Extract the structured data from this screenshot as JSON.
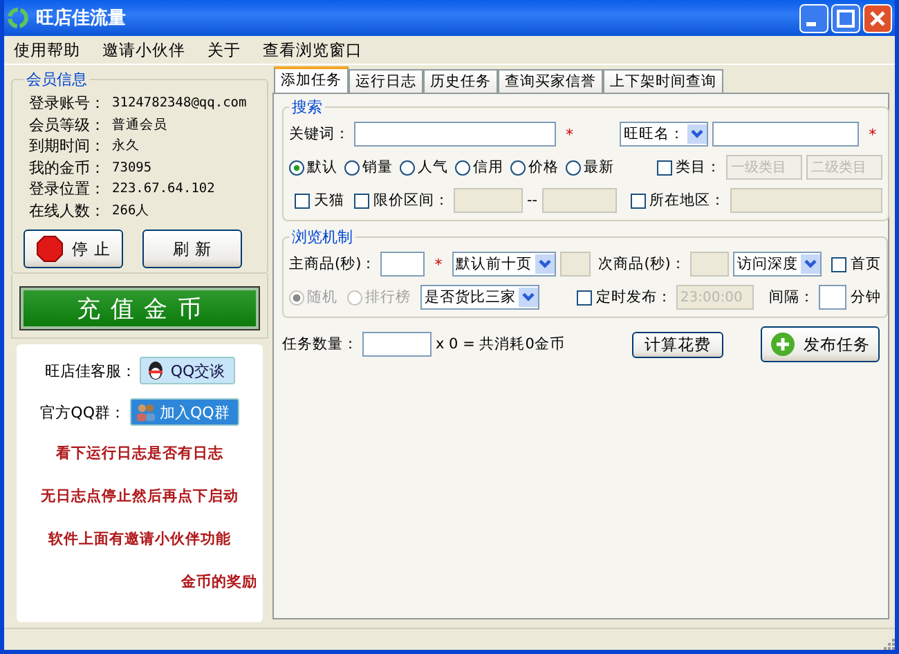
{
  "window": {
    "title": "旺店佳流量"
  },
  "menu": [
    "使用帮助",
    "邀请小伙伴",
    "关于",
    "查看浏览窗口"
  ],
  "member_info": {
    "title": "会员信息",
    "rows": [
      {
        "label": "登录账号：",
        "value": "3124782348@qq.com"
      },
      {
        "label": "会员等级：",
        "value": "普通会员"
      },
      {
        "label": "到期时间：",
        "value": "永久"
      },
      {
        "label": "我的金币：",
        "value": "73095"
      },
      {
        "label": "登录位置：",
        "value": "223.67.64.102"
      },
      {
        "label": "在线人数：",
        "value": "266人"
      }
    ]
  },
  "stop_button": "停 止",
  "refresh_button": "刷 新",
  "recharge_button": "充 值 金 币",
  "support": {
    "service_label": "旺店佳客服：",
    "service_button": "QQ交谈",
    "group_label": "官方QQ群：",
    "group_button": "加入QQ群"
  },
  "notices": [
    "看下运行日志是否有日志",
    "无日志点停止然后再点下启动",
    "软件上面有邀请小伙伴功能",
    "金币的奖励"
  ],
  "tabs": [
    {
      "label": "添加任务",
      "selected": true
    },
    {
      "label": "运行日志",
      "selected": false
    },
    {
      "label": "历史任务",
      "selected": false
    },
    {
      "label": "查询买家信誉",
      "selected": false
    },
    {
      "label": "上下架时间查询",
      "selected": false
    }
  ],
  "search": {
    "title": "搜索",
    "keyword_label": "关键词：",
    "keyword_required": "*",
    "wangwang_label": "旺旺名：",
    "wangwang_required": "*",
    "sort_options": [
      {
        "label": "默认",
        "selected": true
      },
      {
        "label": "销量",
        "selected": false
      },
      {
        "label": "人气",
        "selected": false
      },
      {
        "label": "信用",
        "selected": false
      },
      {
        "label": "价格",
        "selected": false
      },
      {
        "label": "最新",
        "selected": false
      }
    ],
    "category": {
      "label": "类目：",
      "checked": false,
      "level1": "一级类目",
      "level2": "二级类目"
    },
    "tmall": {
      "label": "天猫",
      "checked": false
    },
    "price_range": {
      "label": "限价区间：",
      "checked": false,
      "separator": "--"
    },
    "region": {
      "label": "所在地区：",
      "checked": false
    }
  },
  "browse": {
    "title": "浏览机制",
    "main_label": "主商品(秒)：",
    "main_required": "*",
    "main_select": "默认前十页",
    "secondary_label": "次商品(秒)：",
    "depth_select": "访问深度",
    "homepage": {
      "label": "首页",
      "checked": false
    },
    "modes": [
      {
        "label": "随机",
        "selected": true,
        "disabled": true
      },
      {
        "label": "排行榜",
        "selected": false,
        "disabled": true
      }
    ],
    "compare_select": "是否货比三家",
    "schedule": {
      "label": "定时发布：",
      "checked": false,
      "time": "23:00:00"
    },
    "interval_label": "间隔：",
    "interval_unit": "分钟"
  },
  "task": {
    "count_label": "任务数量：",
    "formula": "x 0 = 共消耗0金币",
    "calc_button": "计算花费",
    "publish_button": "发布任务"
  }
}
